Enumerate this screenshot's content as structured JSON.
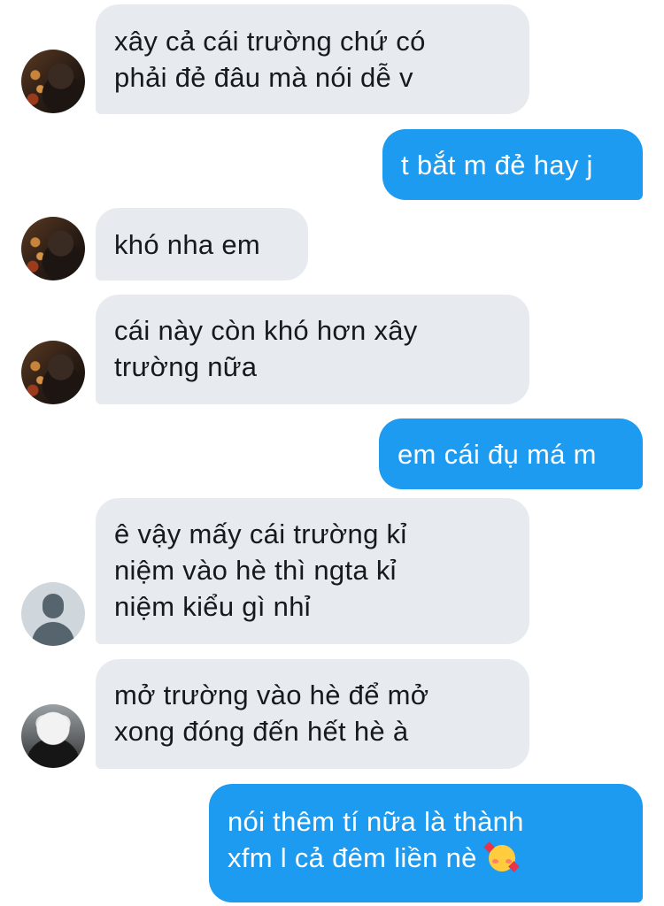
{
  "messages": [
    {
      "side": "incoming",
      "avatar": "photo-avatar",
      "lines": [
        "xây cả cái trường chứ có",
        "phải đẻ đâu mà nói dễ v"
      ]
    },
    {
      "side": "outgoing",
      "lines": [
        "t bắt m đẻ hay j"
      ]
    },
    {
      "side": "incoming",
      "avatar": "photo-avatar",
      "lines": [
        "khó nha em"
      ]
    },
    {
      "side": "incoming",
      "avatar": "photo-avatar",
      "lines": [
        "cái này còn khó hơn xây",
        "trường nữa"
      ]
    },
    {
      "side": "outgoing",
      "lines": [
        "em cái đụ má m"
      ]
    },
    {
      "side": "incoming",
      "avatar": "default-avatar",
      "lines": [
        "ê vậy mấy cái trường kỉ",
        "niệm vào hè thì ngta kỉ",
        "niệm kiểu gì nhỉ"
      ]
    },
    {
      "side": "incoming",
      "avatar": "white-hair-avatar",
      "lines": [
        "mở trường vào hè để mở",
        "xong đóng đến hết hè à"
      ]
    },
    {
      "side": "outgoing",
      "lines": [
        "nói thêm tí nữa là thành",
        "xfm l cả đêm liền nè"
      ],
      "emoji": "smiling-face-with-hearts-icon"
    }
  ],
  "colors": {
    "incoming_bubble": "#e7eaee",
    "outgoing_bubble": "#1d9bf0",
    "incoming_text": "#151a1e",
    "outgoing_text": "#ffffff"
  }
}
